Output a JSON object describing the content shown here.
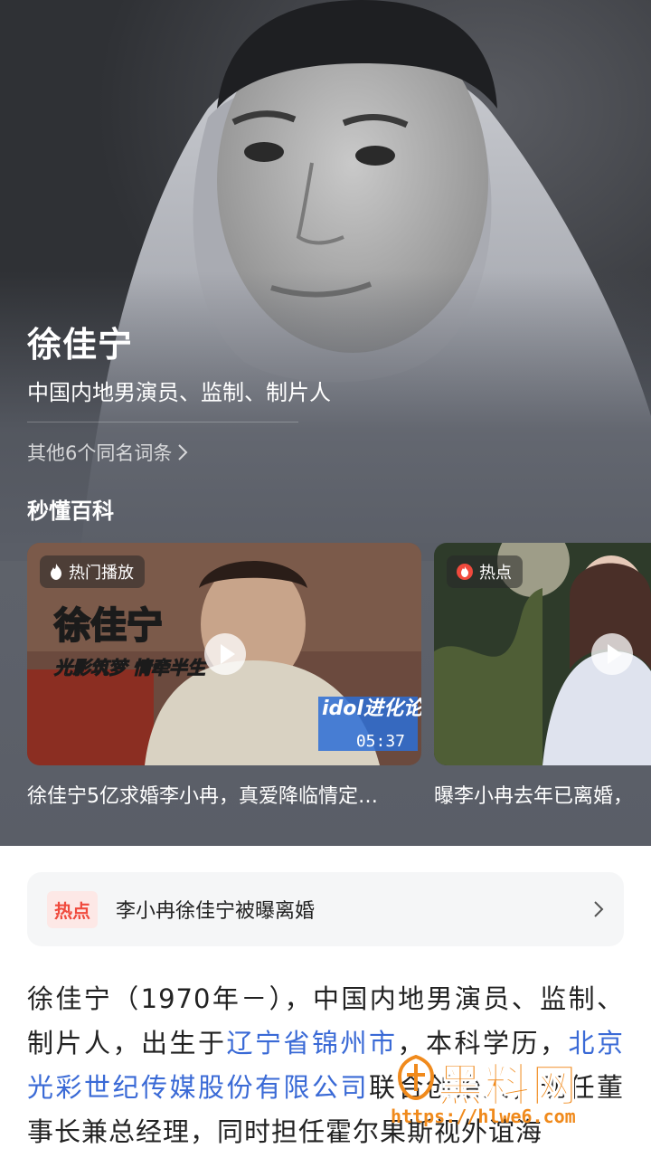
{
  "profile": {
    "name": "徐佳宁",
    "subtitle": "中国内地男演员、监制、制片人",
    "other_entries": "其他6个同名词条"
  },
  "section": {
    "title": "秒懂百科"
  },
  "videos": [
    {
      "badge": "热门播放",
      "title_overlay": "徐佳宁",
      "subtitle_overlay": "光影筑梦 情牵半生",
      "brand_overlay": "idol进化论",
      "duration": "05:37",
      "caption": "徐佳宁5亿求婚李小冉，真爱降临情定…"
    },
    {
      "badge": "热点",
      "caption": "曝李小冉去年已离婚，"
    }
  ],
  "hot": {
    "tag": "热点",
    "text": "李小冉徐佳宁被曝离婚"
  },
  "intro": {
    "t1": "徐佳宁（1970年－），中国内地男演员、监制、制片人，出生于",
    "link1": "辽宁省锦州市",
    "t2": "，本科学历，",
    "link2": "北京光彩世纪传媒股份有限公司",
    "t3": "联合创始人，现任董事长兼总经理，同时担任霍尔果斯视外谊海"
  },
  "watermark": {
    "name": "黑料网",
    "url": "https://hlwe6.com"
  },
  "colors": {
    "hot_red": "#f04a3d",
    "link_blue": "#3a6ad6",
    "watermark_orange": "#f08a1c"
  },
  "icons": [
    "flame-icon",
    "play-icon",
    "chevron-right-icon"
  ]
}
